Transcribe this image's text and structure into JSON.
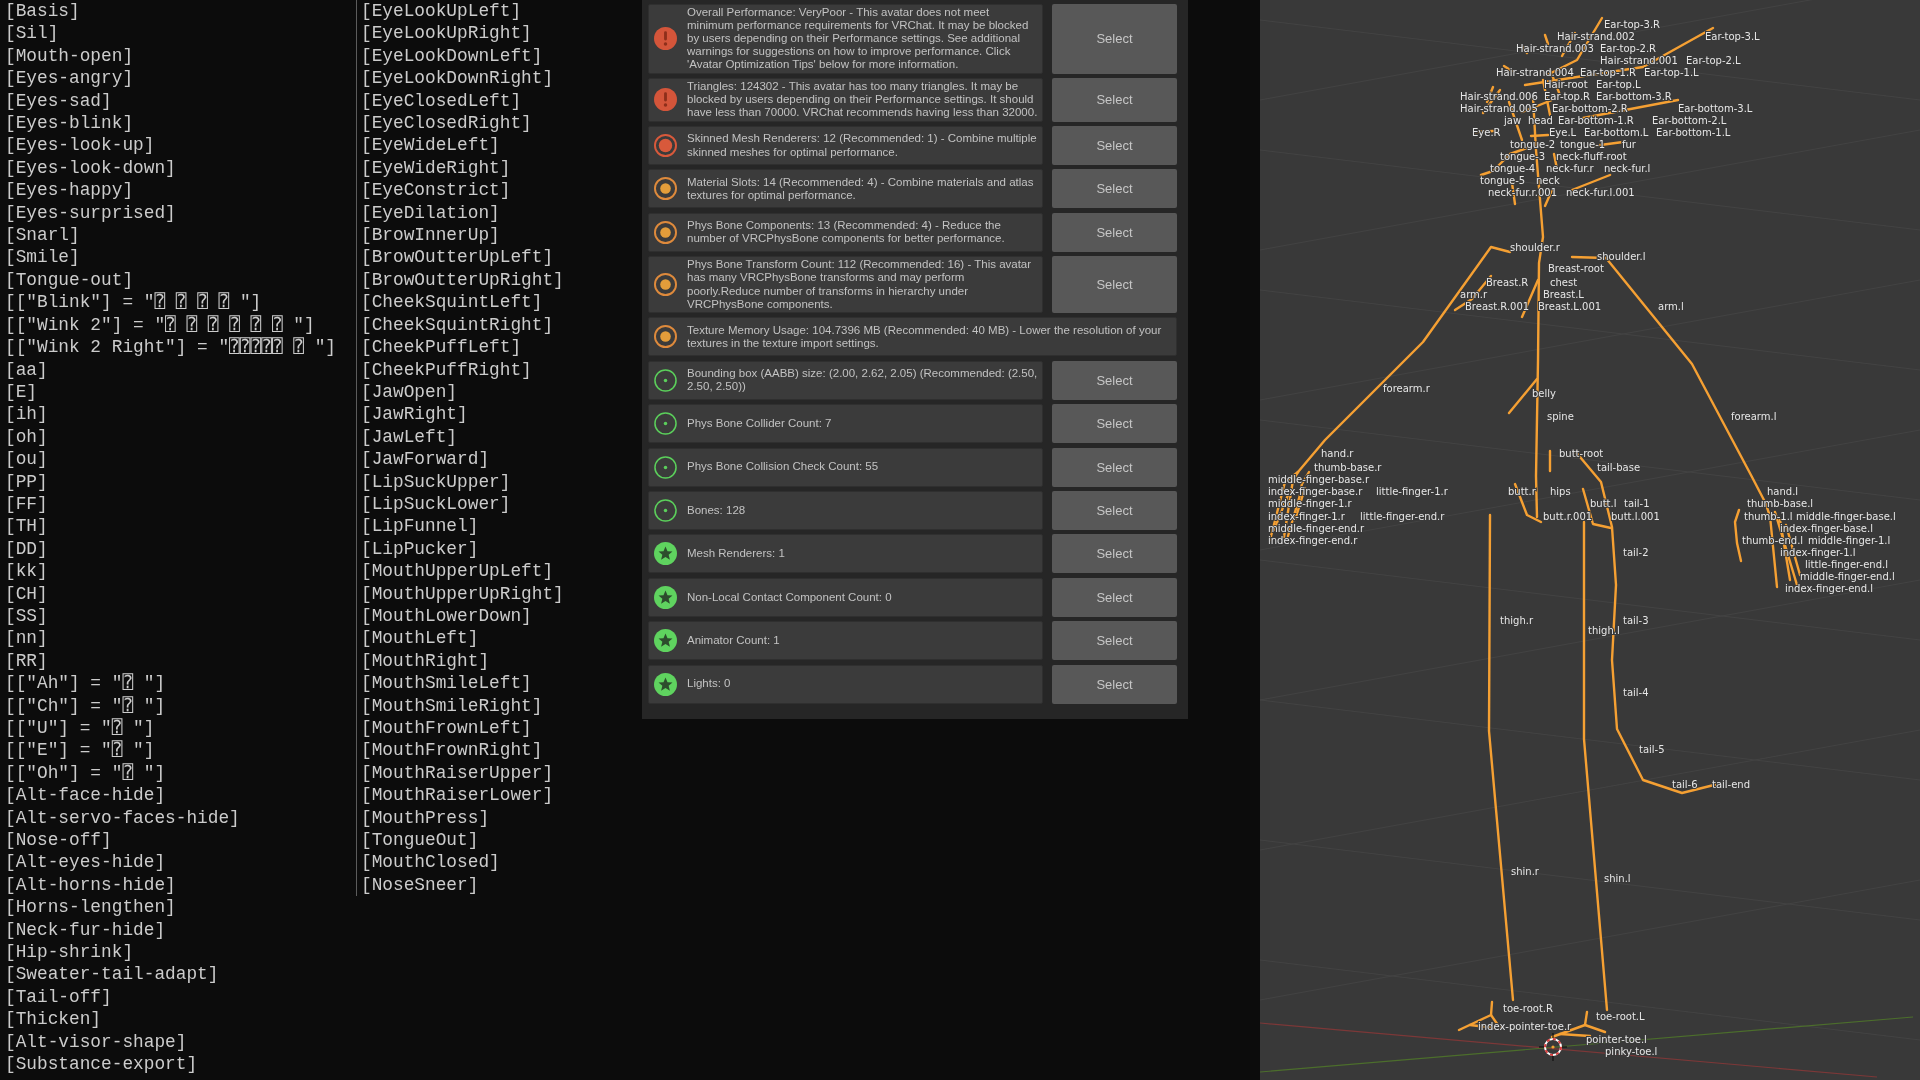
{
  "console_list": {
    "column_1": [
      "[Basis]",
      "[Sil]",
      "[Mouth-open]",
      "[Eyes-angry]",
      "[Eyes-sad]",
      "[Eyes-blink]",
      "[Eyes-look-up]",
      "[Eyes-look-down]",
      "[Eyes-happy]",
      "[Eyes-surprised]",
      "[Snarl]",
      "[Smile]",
      "[Tongue-out]",
      "[[\"Blink\"] = \"⍰ ⍰ ⍰ ⍰ \"]",
      "[[\"Wink 2\"] = \"⍰ ⍰ ⍰ ⍰ ⍰ ⍰ \"]",
      "[[\"Wink 2 Right\"] = \"⍰⍰⍰⍰⍰ ⍰ \"]",
      "[aa]",
      "[E]",
      "[ih]",
      "[oh]",
      "[ou]",
      "[PP]",
      "[FF]",
      "[TH]",
      "[DD]",
      "[kk]",
      "[CH]",
      "[SS]",
      "[nn]",
      "[RR]",
      "[[\"Ah\"] = \"⍰ \"]",
      "[[\"Ch\"] = \"⍰ \"]",
      "[[\"U\"] = \"⍰ \"]",
      "[[\"E\"] = \"⍰ \"]",
      "[[\"Oh\"] = \"⍰ \"]",
      "[Alt-face-hide]",
      "[Alt-servo-faces-hide]",
      "[Nose-off]",
      "[Alt-eyes-hide]",
      "[Alt-horns-hide]",
      "[Horns-lengthen]",
      "[Neck-fur-hide]",
      "[Hip-shrink]",
      "[Sweater-tail-adapt]",
      "[Tail-off]",
      "[Thicken]",
      "[Alt-visor-shape]",
      "[Substance-export]"
    ],
    "column_2": [
      "[EyeLookUpLeft]",
      "[EyeLookUpRight]",
      "[EyeLookDownLeft]",
      "[EyeLookDownRight]",
      "[EyeClosedLeft]",
      "[EyeClosedRight]",
      "[EyeWideLeft]",
      "[EyeWideRight]",
      "[EyeConstrict]",
      "[EyeDilation]",
      "[BrowInnerUp]",
      "[BrowOutterUpLeft]",
      "[BrowOutterUpRight]",
      "[CheekSquintLeft]",
      "[CheekSquintRight]",
      "[CheekPuffLeft]",
      "[CheekPuffRight]",
      "[JawOpen]",
      "[JawRight]",
      "[JawLeft]",
      "[JawForward]",
      "[LipSuckUpper]",
      "[LipSuckLower]",
      "[LipFunnel]",
      "[LipPucker]",
      "[MouthUpperUpLeft]",
      "[MouthUpperUpRight]",
      "[MouthLowerDown]",
      "[MouthLeft]",
      "[MouthRight]",
      "[MouthSmileLeft]",
      "[MouthSmileRight]",
      "[MouthFrownLeft]",
      "[MouthFrownRight]",
      "[MouthRaiserUpper]",
      "[MouthRaiserLower]",
      "[MouthPress]",
      "[TongueOut]",
      "[MouthClosed]",
      "[NoseSneer]"
    ]
  },
  "performance_panel": {
    "rows": [
      {
        "kind": "very_poor",
        "message": "Overall Performance: VeryPoor - This avatar does not meet minimum performance requirements for VRChat. It may be blocked by users depending on their Performance settings. See additional warnings for suggestions on how to improve performance. Click 'Avatar Optimization Tips' below for more information.",
        "button": "Select"
      },
      {
        "kind": "very_poor",
        "message": "Triangles: 124302 - This avatar has too many triangles. It may be blocked by users depending on their Performance settings. It should have less than 70000. VRChat recommends having less than 32000.",
        "button": "Select"
      },
      {
        "kind": "poor",
        "message": "Skinned Mesh Renderers: 12 (Recommended: 1) - Combine multiple skinned meshes for optimal performance.",
        "button": "Select"
      },
      {
        "kind": "medium",
        "message": "Material Slots: 14 (Recommended: 4) - Combine materials and atlas textures for optimal performance.",
        "button": "Select"
      },
      {
        "kind": "medium",
        "message": "Phys Bone Components: 13 (Recommended: 4) - Reduce the number of VRCPhysBone components for better performance.",
        "button": "Select"
      },
      {
        "kind": "medium",
        "message": "Phys Bone Transform Count: 112 (Recommended: 16) - This avatar has many VRCPhysBone transforms and may perform poorly.Reduce number of transforms in hierarchy under VRCPhysBone components.",
        "button": "Select"
      },
      {
        "kind": "medium",
        "message": "Texture Memory Usage: 104.7396 MB (Recommended: 40 MB) - Lower the resolution of your textures in the texture import settings."
      },
      {
        "kind": "good",
        "message": "Bounding box (AABB) size: (2.00, 2.62, 2.05) (Recommended: (2.50, 2.50, 2.50))",
        "button": "Select"
      },
      {
        "kind": "good",
        "message": "Phys Bone Collider Count: 7",
        "button": "Select"
      },
      {
        "kind": "good",
        "message": "Phys Bone Collision Check Count: 55",
        "button": "Select"
      },
      {
        "kind": "good",
        "message": "Bones: 128",
        "button": "Select"
      },
      {
        "kind": "excellent",
        "message": "Mesh Renderers: 1",
        "button": "Select"
      },
      {
        "kind": "excellent",
        "message": "Non-Local Contact Component Count: 0",
        "button": "Select"
      },
      {
        "kind": "excellent",
        "message": "Animator Count: 1",
        "button": "Select"
      },
      {
        "kind": "excellent",
        "message": "Lights: 0",
        "button": "Select"
      }
    ]
  },
  "viewport": {
    "bone_labels": [
      "Ear-top-3.R",
      "Hair-strand.002",
      "Ear-top-3.L",
      "Hair-strand.003",
      "Ear-top-2.R",
      "Hair-strand.001",
      "Ear-top-2.L",
      "Hair-strand.004",
      "Ear-top-1.R",
      "Ear-top-1.L",
      "Hair-root",
      "Ear-top.L",
      "Hair-strand.006",
      "Ear-top.R",
      "Ear-bottom-3.R",
      "Hair-strand.005",
      "Ear-bottom-2.R",
      "Ear-bottom-3.L",
      "jaw",
      "head",
      "Ear-bottom-1.R",
      "Ear-bottom-2.L",
      "Eye.R",
      "Eye.L",
      "Ear-bottom.L",
      "Ear-bottom-1.L",
      "tongue-2",
      "tongue-1",
      "fur",
      "tongue-3",
      "neck-fluff-root",
      "tongue-4",
      "neck-fur.r",
      "neck-fur.l",
      "tongue-5",
      "neck",
      "neck-fur.r.001",
      "neck-fur.l.001",
      "shoulder.r",
      "shoulder.l",
      "Breast-root",
      "Breast.R",
      "chest",
      "arm.r",
      "Breast.L",
      "Breast.R.001",
      "Breast.L.001",
      "arm.l",
      "forearm.r",
      "belly",
      "spine",
      "forearm.l",
      "hand.r",
      "butt-root",
      "thumb-base.r",
      "tail-base",
      "middle-finger-base.r",
      "index-finger-base.r",
      "little-finger-1.r",
      "butt.r",
      "hips",
      "hand.l",
      "middle-finger-1.r",
      "butt.l",
      "tail-1",
      "thumb-base.l",
      "index-finger-1.r",
      "little-finger-end.r",
      "butt.r.001",
      "butt.l.001",
      "thumb-1.l",
      "middle-finger-base.l",
      "middle-finger-end.r",
      "index-finger-base.l",
      "index-finger-end.r",
      "thumb-end.l",
      "middle-finger-1.l",
      "tail-2",
      "index-finger-1.l",
      "little-finger-end.l",
      "middle-finger-end.l",
      "index-finger-end.l",
      "thigh.r",
      "tail-3",
      "thigh.l",
      "tail-4",
      "tail-5",
      "tail-6",
      "tail-end",
      "shin.r",
      "shin.l",
      "toe-root.R",
      "toe-root.L",
      "index-pointer-toe.r",
      "pointer-toe.l",
      "pinky-toe.l"
    ]
  }
}
